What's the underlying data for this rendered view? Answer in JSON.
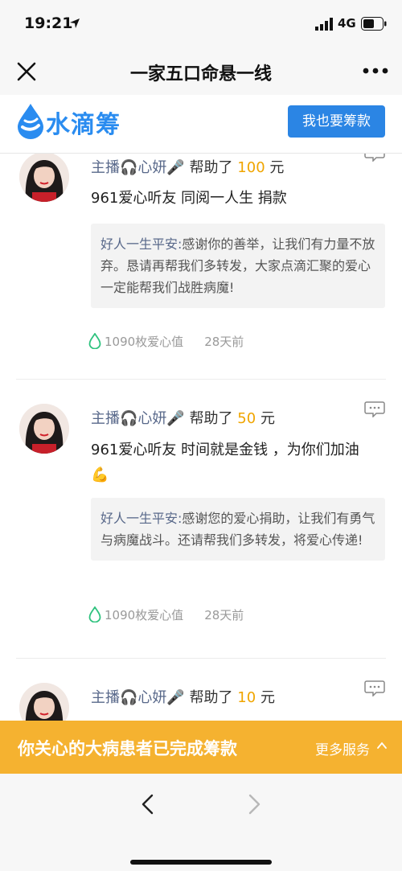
{
  "status": {
    "time": "19:21",
    "network": "4G"
  },
  "nav": {
    "title": "一家五口命悬一线"
  },
  "brand": {
    "name": "水滴筹",
    "cta": "我也要筹款"
  },
  "colors": {
    "brand_blue": "#2b85e4",
    "amount_gold": "#f0a500",
    "banner_orange": "#f5b230",
    "love_green": "#2ec27e"
  },
  "feed": {
    "items": [
      {
        "donor": "主播🎧心妍🎤",
        "helped_label": "帮助了",
        "amount": "100",
        "unit": "元",
        "message": "961爱心听友 同阅一人生 捐款",
        "reply_name": "好人一生平安:",
        "reply_text": "感谢你的善举，让我们有力量不放弃。恳请再帮我们多转发，大家点滴汇聚的爱心一定能帮我们战胜病魔!",
        "love": "1090枚爱心值",
        "time": "28天前"
      },
      {
        "donor": "主播🎧心妍🎤",
        "helped_label": "帮助了",
        "amount": "50",
        "unit": "元",
        "message": "961爱心听友 时间就是金钱 ，为你们加油💪",
        "reply_name": "好人一生平安:",
        "reply_text": "感谢您的爱心捐助，让我们有勇气与病魔战斗。还请帮我们多转发，将爱心传递!",
        "love": "1090枚爱心值",
        "time": "28天前"
      },
      {
        "donor": "主播🎧心妍🎤",
        "helped_label": "帮助了",
        "amount": "10",
        "unit": "元"
      }
    ]
  },
  "banner": {
    "text": "你关心的大病患者已完成筹款",
    "more": "更多服务"
  }
}
